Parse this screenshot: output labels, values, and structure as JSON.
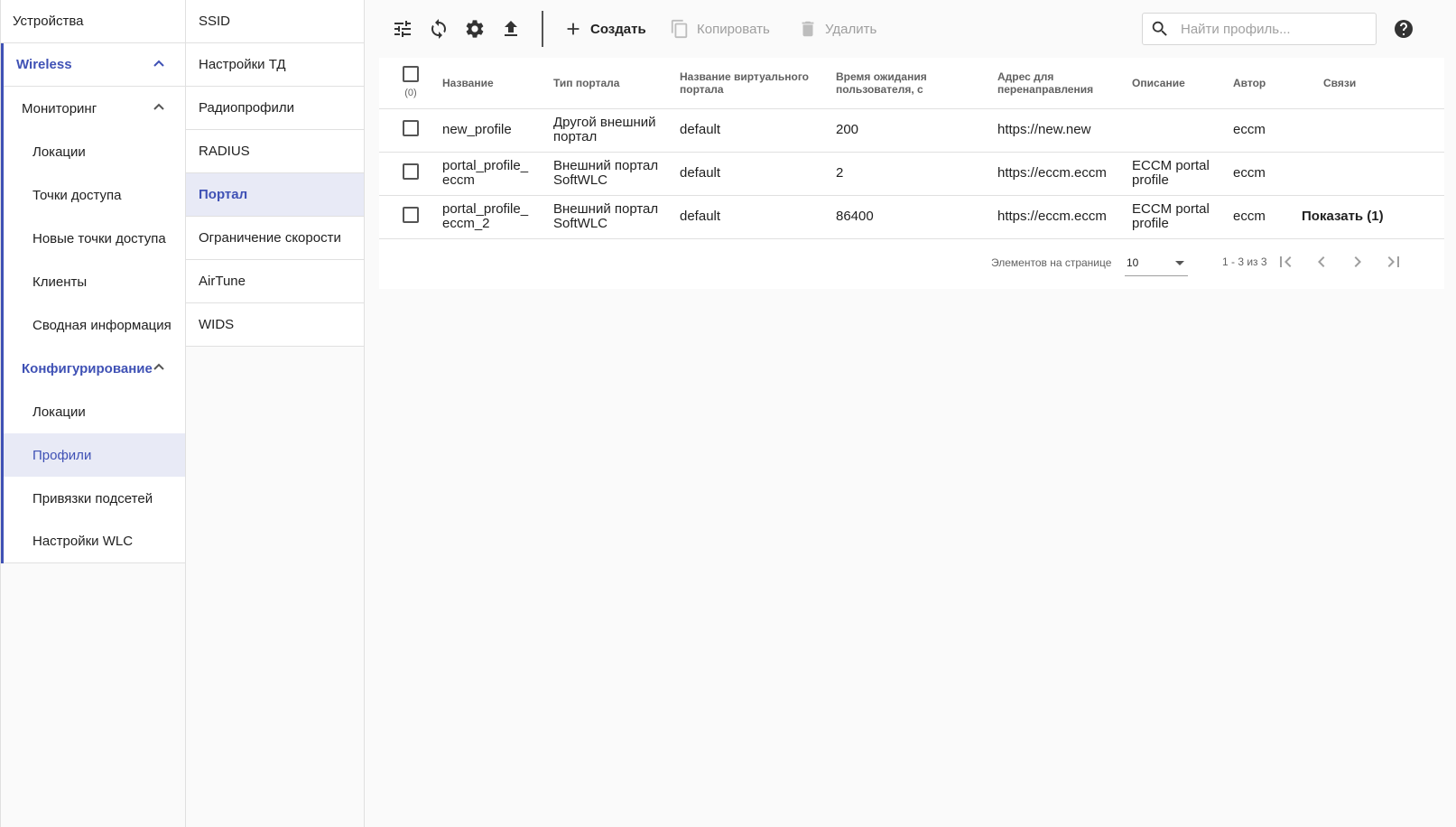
{
  "nav_primary": {
    "devices_label": "Устройства",
    "wireless_label": "Wireless",
    "monitoring_label": "Мониторинг",
    "monitoring_items": [
      "Локации",
      "Точки доступа",
      "Новые точки доступа",
      "Клиенты",
      "Сводная информация"
    ],
    "config_label": "Конфигурирование",
    "config_items": [
      "Локации",
      "Профили",
      "Привязки подсетей",
      "Настройки WLC"
    ]
  },
  "nav_secondary": {
    "items": [
      "SSID",
      "Настройки ТД",
      "Радиопрофили",
      "RADIUS",
      "Портал",
      "Ограничение скорости",
      "AirTune",
      "WIDS"
    ]
  },
  "toolbar": {
    "create_label": "Создать",
    "copy_label": "Копировать",
    "delete_label": "Удалить"
  },
  "search": {
    "placeholder": "Найти профиль..."
  },
  "table": {
    "selected_count": "(0)",
    "headers": {
      "name": "Название",
      "portal_type": "Тип портала",
      "virtual_portal": "Название виртуального портала",
      "timeout": "Время ожидания пользователя, с",
      "redirect": "Адрес для перенаправления",
      "description": "Описание",
      "author": "Автор",
      "links": "Связи"
    },
    "rows": [
      {
        "name": "new_profile",
        "portal_type": "Другой внешний портал",
        "virtual_portal": "default",
        "timeout": "200",
        "redirect": "https://new.new",
        "description": "",
        "author": "eccm",
        "links": ""
      },
      {
        "name": "portal_profile_ eccm",
        "portal_type": "Внешний портал SoftWLC",
        "virtual_portal": "default",
        "timeout": "2",
        "redirect": "https://eccm.eccm",
        "description": "ECCM portal profile",
        "author": "eccm",
        "links": ""
      },
      {
        "name": "portal_profile_ eccm_2",
        "portal_type": "Внешний портал SoftWLC",
        "virtual_portal": "default",
        "timeout": "86400",
        "redirect": "https://eccm.eccm",
        "description": "ECCM portal profile",
        "author": "eccm",
        "links": "Показать (1)"
      }
    ]
  },
  "paginator": {
    "items_per_page_label": "Элементов на странице",
    "items_per_page_value": "10",
    "range_label": "1 - 3 из 3"
  },
  "colors": {
    "accent": "#3f51b5",
    "active_bg": "#e8eaf6"
  }
}
